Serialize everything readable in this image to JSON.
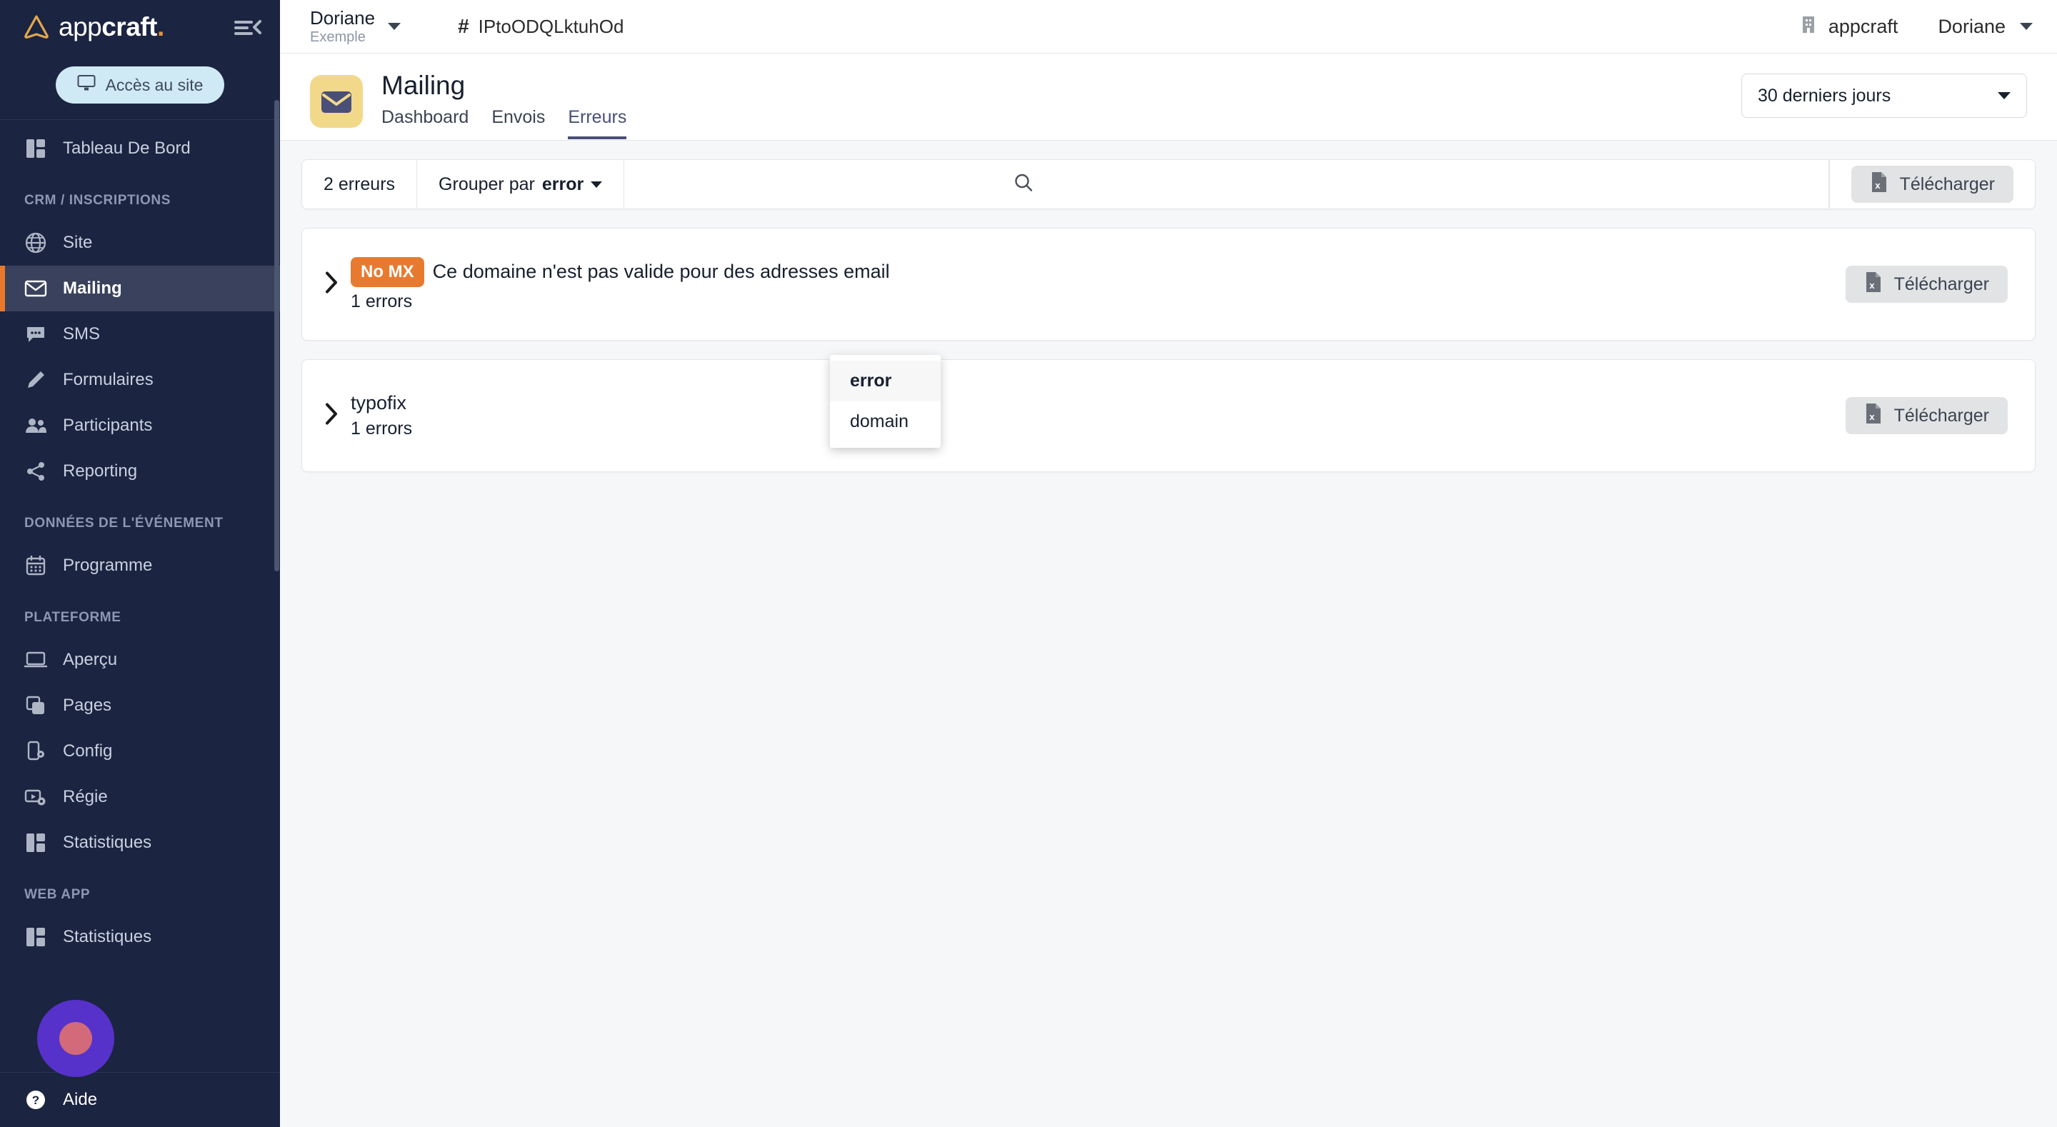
{
  "brand": {
    "logo_text_light": "app",
    "logo_text_bold": "craft",
    "logo_dot": ".",
    "accent_orange": "#e8792b",
    "sidebar_bg": "#1b2440"
  },
  "sidebar": {
    "access_button": "Accès au site",
    "groups": [
      {
        "label": null,
        "items": [
          {
            "label": "Tableau De Bord",
            "icon": "dashboard-icon",
            "active": false
          }
        ]
      },
      {
        "label": "CRM / INSCRIPTIONS",
        "items": [
          {
            "label": "Site",
            "icon": "globe-icon",
            "active": false
          },
          {
            "label": "Mailing",
            "icon": "envelope-icon",
            "active": true
          },
          {
            "label": "SMS",
            "icon": "chat-bubble-icon",
            "active": false
          },
          {
            "label": "Formulaires",
            "icon": "pencil-icon",
            "active": false
          },
          {
            "label": "Participants",
            "icon": "people-icon",
            "active": false
          },
          {
            "label": "Reporting",
            "icon": "share-icon",
            "active": false
          }
        ]
      },
      {
        "label": "DONNÉES DE L'ÉVÉNEMENT",
        "items": [
          {
            "label": "Programme",
            "icon": "calendar-icon",
            "active": false
          }
        ]
      },
      {
        "label": "PLATEFORME",
        "items": [
          {
            "label": "Aperçu",
            "icon": "laptop-icon",
            "active": false
          },
          {
            "label": "Pages",
            "icon": "pages-icon",
            "active": false
          },
          {
            "label": "Config",
            "icon": "phone-gear-icon",
            "active": false
          },
          {
            "label": "Régie",
            "icon": "video-gear-icon",
            "active": false
          },
          {
            "label": "Statistiques",
            "icon": "dashboard-icon",
            "active": false
          }
        ]
      },
      {
        "label": "WEB APP",
        "items": [
          {
            "label": "Statistiques",
            "icon": "dashboard-icon",
            "active": false
          }
        ]
      }
    ],
    "help_item": {
      "label": "Aide",
      "icon": "help-circle-icon"
    }
  },
  "topbar": {
    "account_name": "Doriane",
    "account_sub": "Exemple",
    "hash_symbol": "#",
    "event_id": "IPtoODQLktuhOd",
    "org_name": "appcraft",
    "user_name": "Doriane"
  },
  "page": {
    "icon": "envelope-icon",
    "title": "Mailing",
    "tabs": [
      {
        "label": "Dashboard",
        "active": false
      },
      {
        "label": "Envois",
        "active": false
      },
      {
        "label": "Erreurs",
        "active": true
      }
    ],
    "date_range": "30 derniers jours"
  },
  "toolbar": {
    "error_count": "2 erreurs",
    "group_by_prefix": "Grouper par",
    "group_by_value": "error",
    "search_placeholder": "",
    "search_value": "",
    "download_label": "Télécharger"
  },
  "dropdown": {
    "open": true,
    "options": [
      {
        "label": "error",
        "selected": true
      },
      {
        "label": "domain",
        "selected": false
      }
    ]
  },
  "error_groups": [
    {
      "badge": "No MX",
      "description": "Ce domaine n'est pas valide pour des adresses email",
      "title": null,
      "count": "1 errors",
      "download_label": "Télécharger"
    },
    {
      "badge": null,
      "description": null,
      "title": "typofix",
      "count": "1 errors",
      "download_label": "Télécharger"
    }
  ]
}
